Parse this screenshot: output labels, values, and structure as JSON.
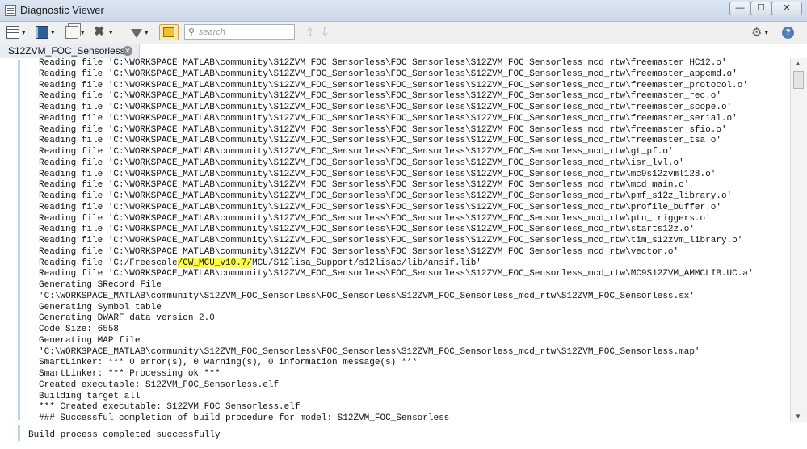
{
  "window": {
    "title": "Diagnostic Viewer",
    "min_glyph": "—",
    "max_glyph": "☐",
    "close_glyph": "✕"
  },
  "toolbar": {
    "search_placeholder": "search",
    "up_arrow": "⇧",
    "down_arrow": "⇩",
    "caret": "▾"
  },
  "tabs": [
    {
      "label": "S12ZVM_FOC_Sensorless"
    }
  ],
  "log": {
    "lines_before": [
      "Reading file 'C:\\WORKSPACE_MATLAB\\community\\S12ZVM_FOC_Sensorless\\FOC_Sensorless\\S12ZVM_FOC_Sensorless_mcd_rtw\\freemaster_HC12.o'",
      "Reading file 'C:\\WORKSPACE_MATLAB\\community\\S12ZVM_FOC_Sensorless\\FOC_Sensorless\\S12ZVM_FOC_Sensorless_mcd_rtw\\freemaster_appcmd.o'",
      "Reading file 'C:\\WORKSPACE_MATLAB\\community\\S12ZVM_FOC_Sensorless\\FOC_Sensorless\\S12ZVM_FOC_Sensorless_mcd_rtw\\freemaster_protocol.o'",
      "Reading file 'C:\\WORKSPACE_MATLAB\\community\\S12ZVM_FOC_Sensorless\\FOC_Sensorless\\S12ZVM_FOC_Sensorless_mcd_rtw\\freemaster_rec.o'",
      "Reading file 'C:\\WORKSPACE_MATLAB\\community\\S12ZVM_FOC_Sensorless\\FOC_Sensorless\\S12ZVM_FOC_Sensorless_mcd_rtw\\freemaster_scope.o'",
      "Reading file 'C:\\WORKSPACE_MATLAB\\community\\S12ZVM_FOC_Sensorless\\FOC_Sensorless\\S12ZVM_FOC_Sensorless_mcd_rtw\\freemaster_serial.o'",
      "Reading file 'C:\\WORKSPACE_MATLAB\\community\\S12ZVM_FOC_Sensorless\\FOC_Sensorless\\S12ZVM_FOC_Sensorless_mcd_rtw\\freemaster_sfio.o'",
      "Reading file 'C:\\WORKSPACE_MATLAB\\community\\S12ZVM_FOC_Sensorless\\FOC_Sensorless\\S12ZVM_FOC_Sensorless_mcd_rtw\\freemaster_tsa.o'",
      "Reading file 'C:\\WORKSPACE_MATLAB\\community\\S12ZVM_FOC_Sensorless\\FOC_Sensorless\\S12ZVM_FOC_Sensorless_mcd_rtw\\gt_pf.o'",
      "Reading file 'C:\\WORKSPACE_MATLAB\\community\\S12ZVM_FOC_Sensorless\\FOC_Sensorless\\S12ZVM_FOC_Sensorless_mcd_rtw\\isr_lvl.o'",
      "Reading file 'C:\\WORKSPACE_MATLAB\\community\\S12ZVM_FOC_Sensorless\\FOC_Sensorless\\S12ZVM_FOC_Sensorless_mcd_rtw\\mc9s12zvml128.o'",
      "Reading file 'C:\\WORKSPACE_MATLAB\\community\\S12ZVM_FOC_Sensorless\\FOC_Sensorless\\S12ZVM_FOC_Sensorless_mcd_rtw\\mcd_main.o'",
      "Reading file 'C:\\WORKSPACE_MATLAB\\community\\S12ZVM_FOC_Sensorless\\FOC_Sensorless\\S12ZVM_FOC_Sensorless_mcd_rtw\\pmf_s12z_library.o'",
      "Reading file 'C:\\WORKSPACE_MATLAB\\community\\S12ZVM_FOC_Sensorless\\FOC_Sensorless\\S12ZVM_FOC_Sensorless_mcd_rtw\\profile_buffer.o'",
      "Reading file 'C:\\WORKSPACE_MATLAB\\community\\S12ZVM_FOC_Sensorless\\FOC_Sensorless\\S12ZVM_FOC_Sensorless_mcd_rtw\\ptu_triggers.o'",
      "Reading file 'C:\\WORKSPACE_MATLAB\\community\\S12ZVM_FOC_Sensorless\\FOC_Sensorless\\S12ZVM_FOC_Sensorless_mcd_rtw\\starts12z.o'",
      "Reading file 'C:\\WORKSPACE_MATLAB\\community\\S12ZVM_FOC_Sensorless\\FOC_Sensorless\\S12ZVM_FOC_Sensorless_mcd_rtw\\tim_s12zvm_library.o'",
      "Reading file 'C:\\WORKSPACE_MATLAB\\community\\S12ZVM_FOC_Sensorless\\FOC_Sensorless\\S12ZVM_FOC_Sensorless_mcd_rtw\\vector.o'"
    ],
    "highlight_line": {
      "prefix": "Reading file 'C:/Freescale",
      "highlighted": "/CW_MCU_v10.7/",
      "suffix": "MCU/S12lisa_Support/s12lisac/lib/ansif.lib'"
    },
    "lines_after": [
      "Reading file 'C:\\WORKSPACE_MATLAB\\community\\S12ZVM_FOC_Sensorless\\FOC_Sensorless\\S12ZVM_FOC_Sensorless_mcd_rtw\\MC9S12ZVM_AMMCLIB.UC.a'",
      "Generating SRecord File",
      "'C:\\WORKSPACE_MATLAB\\community\\S12ZVM_FOC_Sensorless\\FOC_Sensorless\\S12ZVM_FOC_Sensorless_mcd_rtw\\S12ZVM_FOC_Sensorless.sx'",
      "Generating Symbol table",
      "Generating DWARF data version 2.0",
      "Code Size: 6558",
      "Generating MAP file",
      "'C:\\WORKSPACE_MATLAB\\community\\S12ZVM_FOC_Sensorless\\FOC_Sensorless\\S12ZVM_FOC_Sensorless_mcd_rtw\\S12ZVM_FOC_Sensorless.map'",
      "SmartLinker: *** 0 error(s), 0 warning(s), 0 information message(s) ***",
      "SmartLinker: *** Processing ok ***",
      "Created executable: S12ZVM_FOC_Sensorless.elf",
      "Building target all",
      "*** Created executable: S12ZVM_FOC_Sensorless.elf",
      "### Successful completion of build procedure for model: S12ZVM_FOC_Sensorless"
    ]
  },
  "status": {
    "message": "Build process completed successfully"
  }
}
